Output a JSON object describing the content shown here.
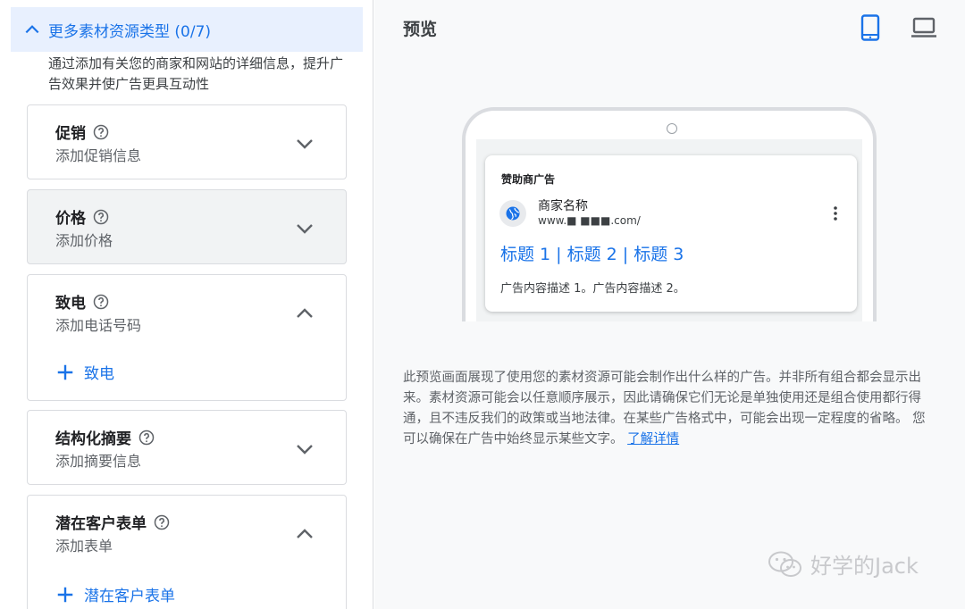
{
  "left": {
    "section_title": "更多素材资源类型 (0/7)",
    "section_desc": "通过添加有关您的商家和网站的详细信息，提升广告效果并使广告更具互动性",
    "cards": [
      {
        "label": "促销",
        "sub": "添加促销信息",
        "expanded": false
      },
      {
        "label": "价格",
        "sub": "添加价格",
        "expanded": false
      },
      {
        "label": "致电",
        "sub": "添加电话号码",
        "expanded": true,
        "add_label": "致电"
      },
      {
        "label": "结构化摘要",
        "sub": "添加摘要信息",
        "expanded": false
      },
      {
        "label": "潜在客户表单",
        "sub": "添加表单",
        "expanded": true,
        "add_label": "潜在客户表单"
      }
    ]
  },
  "right": {
    "title": "预览",
    "ad": {
      "sponsor": "赞助商广告",
      "business": "商家名称",
      "url": "www.■ ■■■.com/",
      "headline": "标题 1 | 标题 2 | 标题 3",
      "description": "广告内容描述 1。广告内容描述 2。"
    },
    "disclaimer": "此预览画面展现了使用您的素材资源可能会制作出什么样的广告。并非所有组合都会显示出来。素材资源可能会以任意顺序展示，因此请确保它们无论是单独使用还是组合使用都行得通，且不违反我们的政策或当地法律。在某些广告格式中，可能会出现一定程度的省略。 您可以确保在广告中始终显示某些文字。",
    "learn_more": "了解详情"
  },
  "watermark": "好学的Jack",
  "colors": {
    "accent": "#1a73e8",
    "header_bg": "#e8f0fe",
    "panel_bg": "#f8f9fa"
  }
}
